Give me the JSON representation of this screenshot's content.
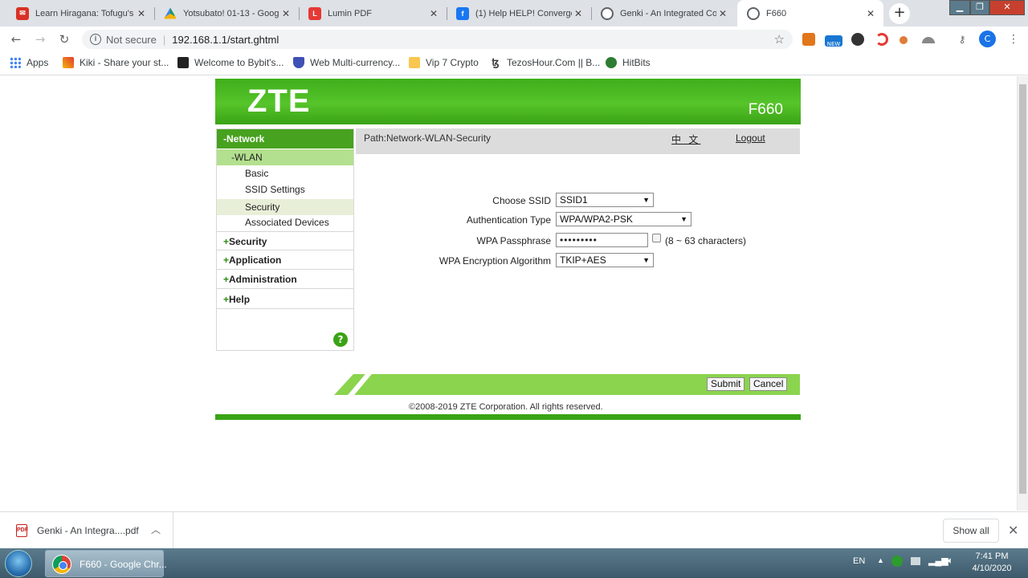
{
  "tabs": [
    {
      "title": "Learn Hiragana: Tofugu's",
      "favicon_color": "#d93025"
    },
    {
      "title": "Yotsubato! 01-13 - Goog",
      "favicon_color": "#1a73e8"
    },
    {
      "title": "Lumin PDF",
      "favicon_color": "#e53935"
    },
    {
      "title": "(1) Help HELP! Converge",
      "favicon_color": "#1877f2"
    },
    {
      "title": "Genki - An Integrated Co",
      "favicon_color": "#5f6368"
    },
    {
      "title": "F660",
      "favicon_color": "#5f6368"
    }
  ],
  "address": {
    "security_label": "Not secure",
    "url": "192.168.1.1/start.ghtml"
  },
  "profile_initial": "C",
  "bookmarks": [
    {
      "label": "Apps"
    },
    {
      "label": "Kiki - Share your st..."
    },
    {
      "label": "Welcome to Bybit's..."
    },
    {
      "label": "Web Multi-currency..."
    },
    {
      "label": "Vip 7 Crypto"
    },
    {
      "label": "TezosHour.Com || B..."
    },
    {
      "label": "HitBits"
    }
  ],
  "router": {
    "brand": "ZTE",
    "model": "F660",
    "path_text": "Path:Network-WLAN-Security",
    "language_link": "中 文",
    "logout_link": "Logout",
    "copyright": "©2008-2019 ZTE Corporation. All rights reserved.",
    "accent_color": "#47a21f"
  },
  "sidebar": {
    "network": "-Network",
    "wlan": "-WLAN",
    "wlan_items": [
      "Basic",
      "SSID Settings",
      "Security",
      "Associated Devices"
    ],
    "selected_item": "Security",
    "sections": [
      "Security",
      "Application",
      "Administration",
      "Help"
    ],
    "plus": "+",
    "help_icon": "?"
  },
  "form": {
    "ssid_label": "Choose SSID",
    "ssid_value": "SSID1",
    "auth_label": "Authentication Type",
    "auth_value": "WPA/WPA2-PSK",
    "pass_label": "WPA Passphrase",
    "pass_value": "•••••••••",
    "pass_hint": "(8 ~ 63 characters)",
    "enc_label": "WPA Encryption Algorithm",
    "enc_value": "TKIP+AES",
    "submit": "Submit",
    "cancel": "Cancel"
  },
  "downloads": {
    "file": "Genki - An Integra....pdf",
    "show_all": "Show all"
  },
  "taskbar": {
    "app": "F660 - Google Chr...",
    "lang": "EN",
    "time": "7:41 PM",
    "date": "4/10/2020"
  }
}
